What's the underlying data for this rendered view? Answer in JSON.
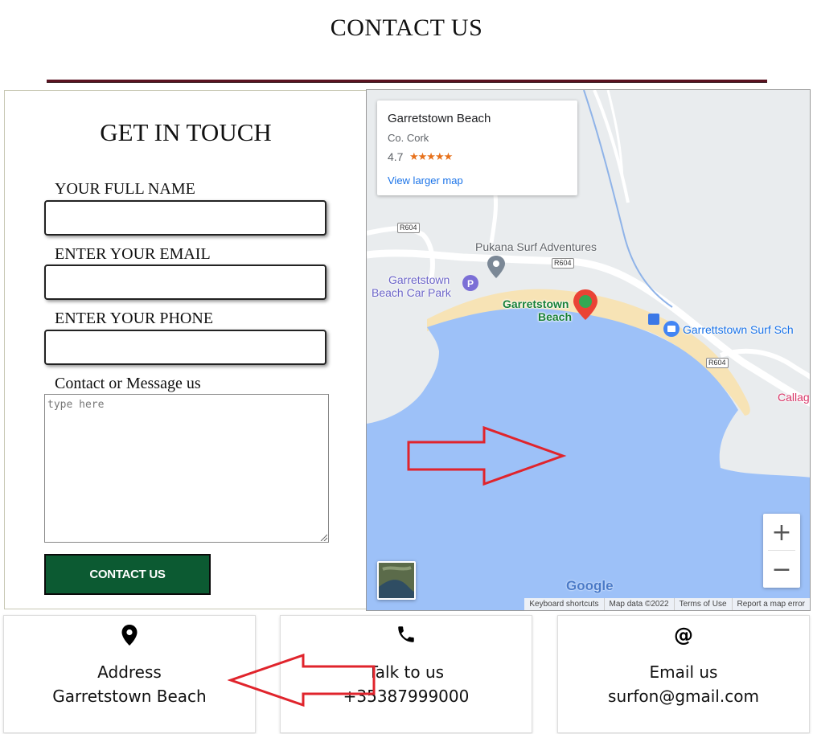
{
  "page": {
    "title": "CONTACT US"
  },
  "form": {
    "heading": "GET IN TOUCH",
    "name_label": "YOUR FULL NAME",
    "email_label": "ENTER YOUR EMAIL",
    "phone_label": "ENTER YOUR PHONE",
    "message_label": "Contact or Message us",
    "message_placeholder": "type here",
    "submit_label": "CONTACT US"
  },
  "map": {
    "place_name": "Garretstown Beach",
    "place_region": "Co. Cork",
    "rating": "4.7",
    "rating_stars": "★★★★★",
    "larger_map_link": "View larger map",
    "road_label": "R604",
    "labels": {
      "surf_adventures": "Pukana Surf Adventures",
      "car_park_line1": "Garretstown",
      "car_park_line2": "Beach Car Park",
      "beach_line1": "Garretstown",
      "beach_line2": "Beach",
      "surf_school": "Garrettstown Surf Sch",
      "callag": "Callag"
    },
    "zoom_in": "+",
    "zoom_out": "−",
    "logo": "Google",
    "attribution": {
      "shortcuts": "Keyboard shortcuts",
      "map_data": "Map data ©2022",
      "terms": "Terms of Use",
      "report": "Report a map error"
    },
    "colors": {
      "water": "#9dc1f8",
      "sand": "#f7e3b5",
      "land": "#e9ecee",
      "pin": "#ea4335"
    }
  },
  "cards": [
    {
      "icon": "location-pin-icon",
      "title": "Address",
      "value": "Garretstown Beach"
    },
    {
      "icon": "phone-icon",
      "title": "Talk to us",
      "value": "+35387999000"
    },
    {
      "icon": "at-sign-icon",
      "glyph": "@",
      "title": "Email us",
      "value": "surfon@gmail.com"
    }
  ],
  "colors": {
    "title_rule": "#5a1220",
    "button": "#0c5a32",
    "annotation_arrow": "#e0242c"
  }
}
